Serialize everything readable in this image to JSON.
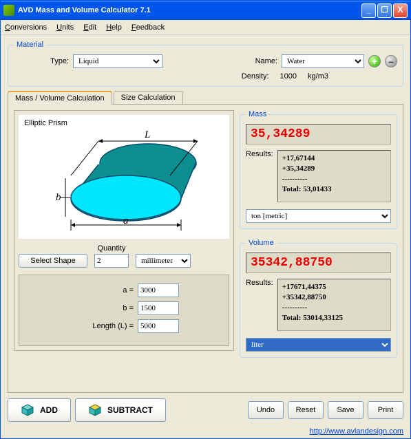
{
  "window": {
    "title": "AVD Mass and Volume Calculator 7.1"
  },
  "menu": {
    "conversions": "Conversions",
    "units": "Units",
    "edit": "Edit",
    "help": "Help",
    "feedback": "Feedback"
  },
  "material": {
    "legend": "Material",
    "type_label": "Type:",
    "type_value": "Liquid",
    "name_label": "Name:",
    "name_value": "Water",
    "density_label": "Density:",
    "density_value": "1000",
    "density_unit": "kg/m3"
  },
  "tabs": {
    "mass_volume": "Mass / Volume  Calculation",
    "size": "Size Calculation"
  },
  "shape": {
    "title": "Elliptic Prism",
    "select_shape": "Select Shape",
    "quantity_label": "Quantity",
    "quantity_value": "2",
    "unit_value": "millimeter",
    "params": {
      "a_label": "a =",
      "a_value": "3000",
      "b_label": "b =",
      "b_value": "1500",
      "len_label": "Length (L) =",
      "len_value": "5000"
    }
  },
  "mass": {
    "legend": "Mass",
    "value": "35,34289",
    "results_label": "Results:",
    "results_line1": "+17,67144",
    "results_line2": "+35,34289",
    "results_sep": "----------",
    "results_total": "Total: 53,01433",
    "unit_value": "ton [metric]"
  },
  "volume": {
    "legend": "Volume",
    "value": "35342,88750",
    "results_label": "Results:",
    "results_line1": "+17671,44375",
    "results_line2": "+35342,88750",
    "results_sep": "----------",
    "results_total": "Total: 53014,33125",
    "unit_value": "liter"
  },
  "buttons": {
    "add": "ADD",
    "subtract": "SUBTRACT",
    "undo": "Undo",
    "reset": "Reset",
    "save": "Save",
    "print": "Print"
  },
  "footer": {
    "url": "http://www.avlandesign.com"
  },
  "colors": {
    "accent_red": "#E80000",
    "link_blue": "#0046D5",
    "panel_bg": "#DEDBC9"
  }
}
